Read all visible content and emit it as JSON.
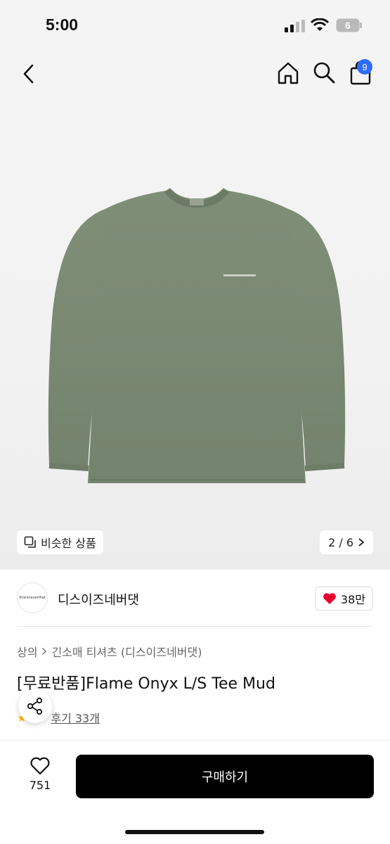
{
  "status": {
    "time": "5:00",
    "battery": "6"
  },
  "nav": {
    "cart_count": "9"
  },
  "gallery": {
    "similar_label": "비슷한 상품",
    "page_indicator": "2 / 6"
  },
  "brand": {
    "logo_text": "thisisneverthat",
    "name": "디스이즈네버댓",
    "likes": "38만"
  },
  "breadcrumb": {
    "category": "상의",
    "subcategory": "긴소매 티셔츠 (디스이즈네버댓)"
  },
  "product": {
    "title": "[무료반품]Flame Onyx L/S Tee Mud",
    "review_link": "후기 33개"
  },
  "bottom": {
    "wish_count": "751",
    "buy_label": "구매하기"
  },
  "colors": {
    "accent_badge": "#2f6bff",
    "heart": "#e8002d",
    "shirt": "#7b8a72",
    "buy_button": "#000000"
  },
  "icons": [
    "back-icon",
    "home-icon",
    "search-icon",
    "bag-icon",
    "similar-icon",
    "chevron-right-icon",
    "heart-icon",
    "share-icon",
    "star-icon"
  ]
}
